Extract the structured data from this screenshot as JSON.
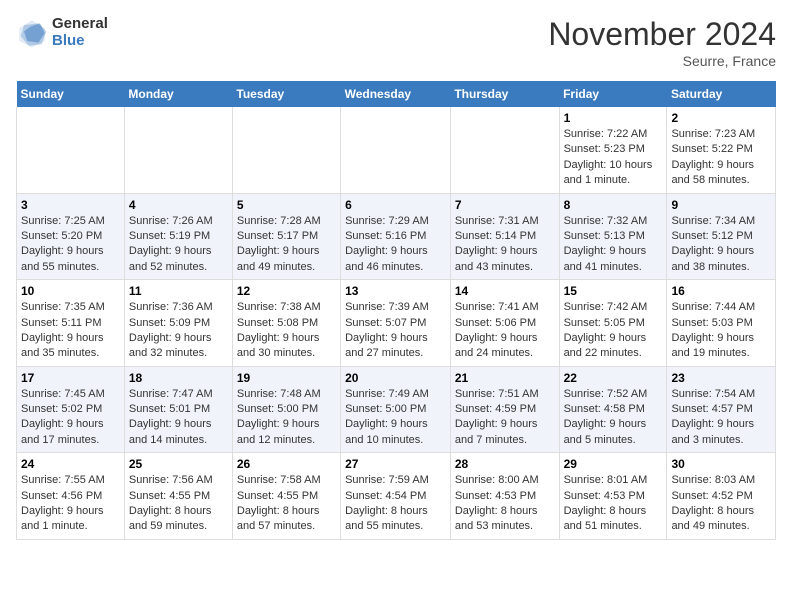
{
  "logo": {
    "general": "General",
    "blue": "Blue"
  },
  "title": "November 2024",
  "location": "Seurre, France",
  "days_of_week": [
    "Sunday",
    "Monday",
    "Tuesday",
    "Wednesday",
    "Thursday",
    "Friday",
    "Saturday"
  ],
  "weeks": [
    [
      {
        "day": "",
        "info": ""
      },
      {
        "day": "",
        "info": ""
      },
      {
        "day": "",
        "info": ""
      },
      {
        "day": "",
        "info": ""
      },
      {
        "day": "",
        "info": ""
      },
      {
        "day": "1",
        "info": "Sunrise: 7:22 AM\nSunset: 5:23 PM\nDaylight: 10 hours and 1 minute."
      },
      {
        "day": "2",
        "info": "Sunrise: 7:23 AM\nSunset: 5:22 PM\nDaylight: 9 hours and 58 minutes."
      }
    ],
    [
      {
        "day": "3",
        "info": "Sunrise: 7:25 AM\nSunset: 5:20 PM\nDaylight: 9 hours and 55 minutes."
      },
      {
        "day": "4",
        "info": "Sunrise: 7:26 AM\nSunset: 5:19 PM\nDaylight: 9 hours and 52 minutes."
      },
      {
        "day": "5",
        "info": "Sunrise: 7:28 AM\nSunset: 5:17 PM\nDaylight: 9 hours and 49 minutes."
      },
      {
        "day": "6",
        "info": "Sunrise: 7:29 AM\nSunset: 5:16 PM\nDaylight: 9 hours and 46 minutes."
      },
      {
        "day": "7",
        "info": "Sunrise: 7:31 AM\nSunset: 5:14 PM\nDaylight: 9 hours and 43 minutes."
      },
      {
        "day": "8",
        "info": "Sunrise: 7:32 AM\nSunset: 5:13 PM\nDaylight: 9 hours and 41 minutes."
      },
      {
        "day": "9",
        "info": "Sunrise: 7:34 AM\nSunset: 5:12 PM\nDaylight: 9 hours and 38 minutes."
      }
    ],
    [
      {
        "day": "10",
        "info": "Sunrise: 7:35 AM\nSunset: 5:11 PM\nDaylight: 9 hours and 35 minutes."
      },
      {
        "day": "11",
        "info": "Sunrise: 7:36 AM\nSunset: 5:09 PM\nDaylight: 9 hours and 32 minutes."
      },
      {
        "day": "12",
        "info": "Sunrise: 7:38 AM\nSunset: 5:08 PM\nDaylight: 9 hours and 30 minutes."
      },
      {
        "day": "13",
        "info": "Sunrise: 7:39 AM\nSunset: 5:07 PM\nDaylight: 9 hours and 27 minutes."
      },
      {
        "day": "14",
        "info": "Sunrise: 7:41 AM\nSunset: 5:06 PM\nDaylight: 9 hours and 24 minutes."
      },
      {
        "day": "15",
        "info": "Sunrise: 7:42 AM\nSunset: 5:05 PM\nDaylight: 9 hours and 22 minutes."
      },
      {
        "day": "16",
        "info": "Sunrise: 7:44 AM\nSunset: 5:03 PM\nDaylight: 9 hours and 19 minutes."
      }
    ],
    [
      {
        "day": "17",
        "info": "Sunrise: 7:45 AM\nSunset: 5:02 PM\nDaylight: 9 hours and 17 minutes."
      },
      {
        "day": "18",
        "info": "Sunrise: 7:47 AM\nSunset: 5:01 PM\nDaylight: 9 hours and 14 minutes."
      },
      {
        "day": "19",
        "info": "Sunrise: 7:48 AM\nSunset: 5:00 PM\nDaylight: 9 hours and 12 minutes."
      },
      {
        "day": "20",
        "info": "Sunrise: 7:49 AM\nSunset: 5:00 PM\nDaylight: 9 hours and 10 minutes."
      },
      {
        "day": "21",
        "info": "Sunrise: 7:51 AM\nSunset: 4:59 PM\nDaylight: 9 hours and 7 minutes."
      },
      {
        "day": "22",
        "info": "Sunrise: 7:52 AM\nSunset: 4:58 PM\nDaylight: 9 hours and 5 minutes."
      },
      {
        "day": "23",
        "info": "Sunrise: 7:54 AM\nSunset: 4:57 PM\nDaylight: 9 hours and 3 minutes."
      }
    ],
    [
      {
        "day": "24",
        "info": "Sunrise: 7:55 AM\nSunset: 4:56 PM\nDaylight: 9 hours and 1 minute."
      },
      {
        "day": "25",
        "info": "Sunrise: 7:56 AM\nSunset: 4:55 PM\nDaylight: 8 hours and 59 minutes."
      },
      {
        "day": "26",
        "info": "Sunrise: 7:58 AM\nSunset: 4:55 PM\nDaylight: 8 hours and 57 minutes."
      },
      {
        "day": "27",
        "info": "Sunrise: 7:59 AM\nSunset: 4:54 PM\nDaylight: 8 hours and 55 minutes."
      },
      {
        "day": "28",
        "info": "Sunrise: 8:00 AM\nSunset: 4:53 PM\nDaylight: 8 hours and 53 minutes."
      },
      {
        "day": "29",
        "info": "Sunrise: 8:01 AM\nSunset: 4:53 PM\nDaylight: 8 hours and 51 minutes."
      },
      {
        "day": "30",
        "info": "Sunrise: 8:03 AM\nSunset: 4:52 PM\nDaylight: 8 hours and 49 minutes."
      }
    ]
  ]
}
